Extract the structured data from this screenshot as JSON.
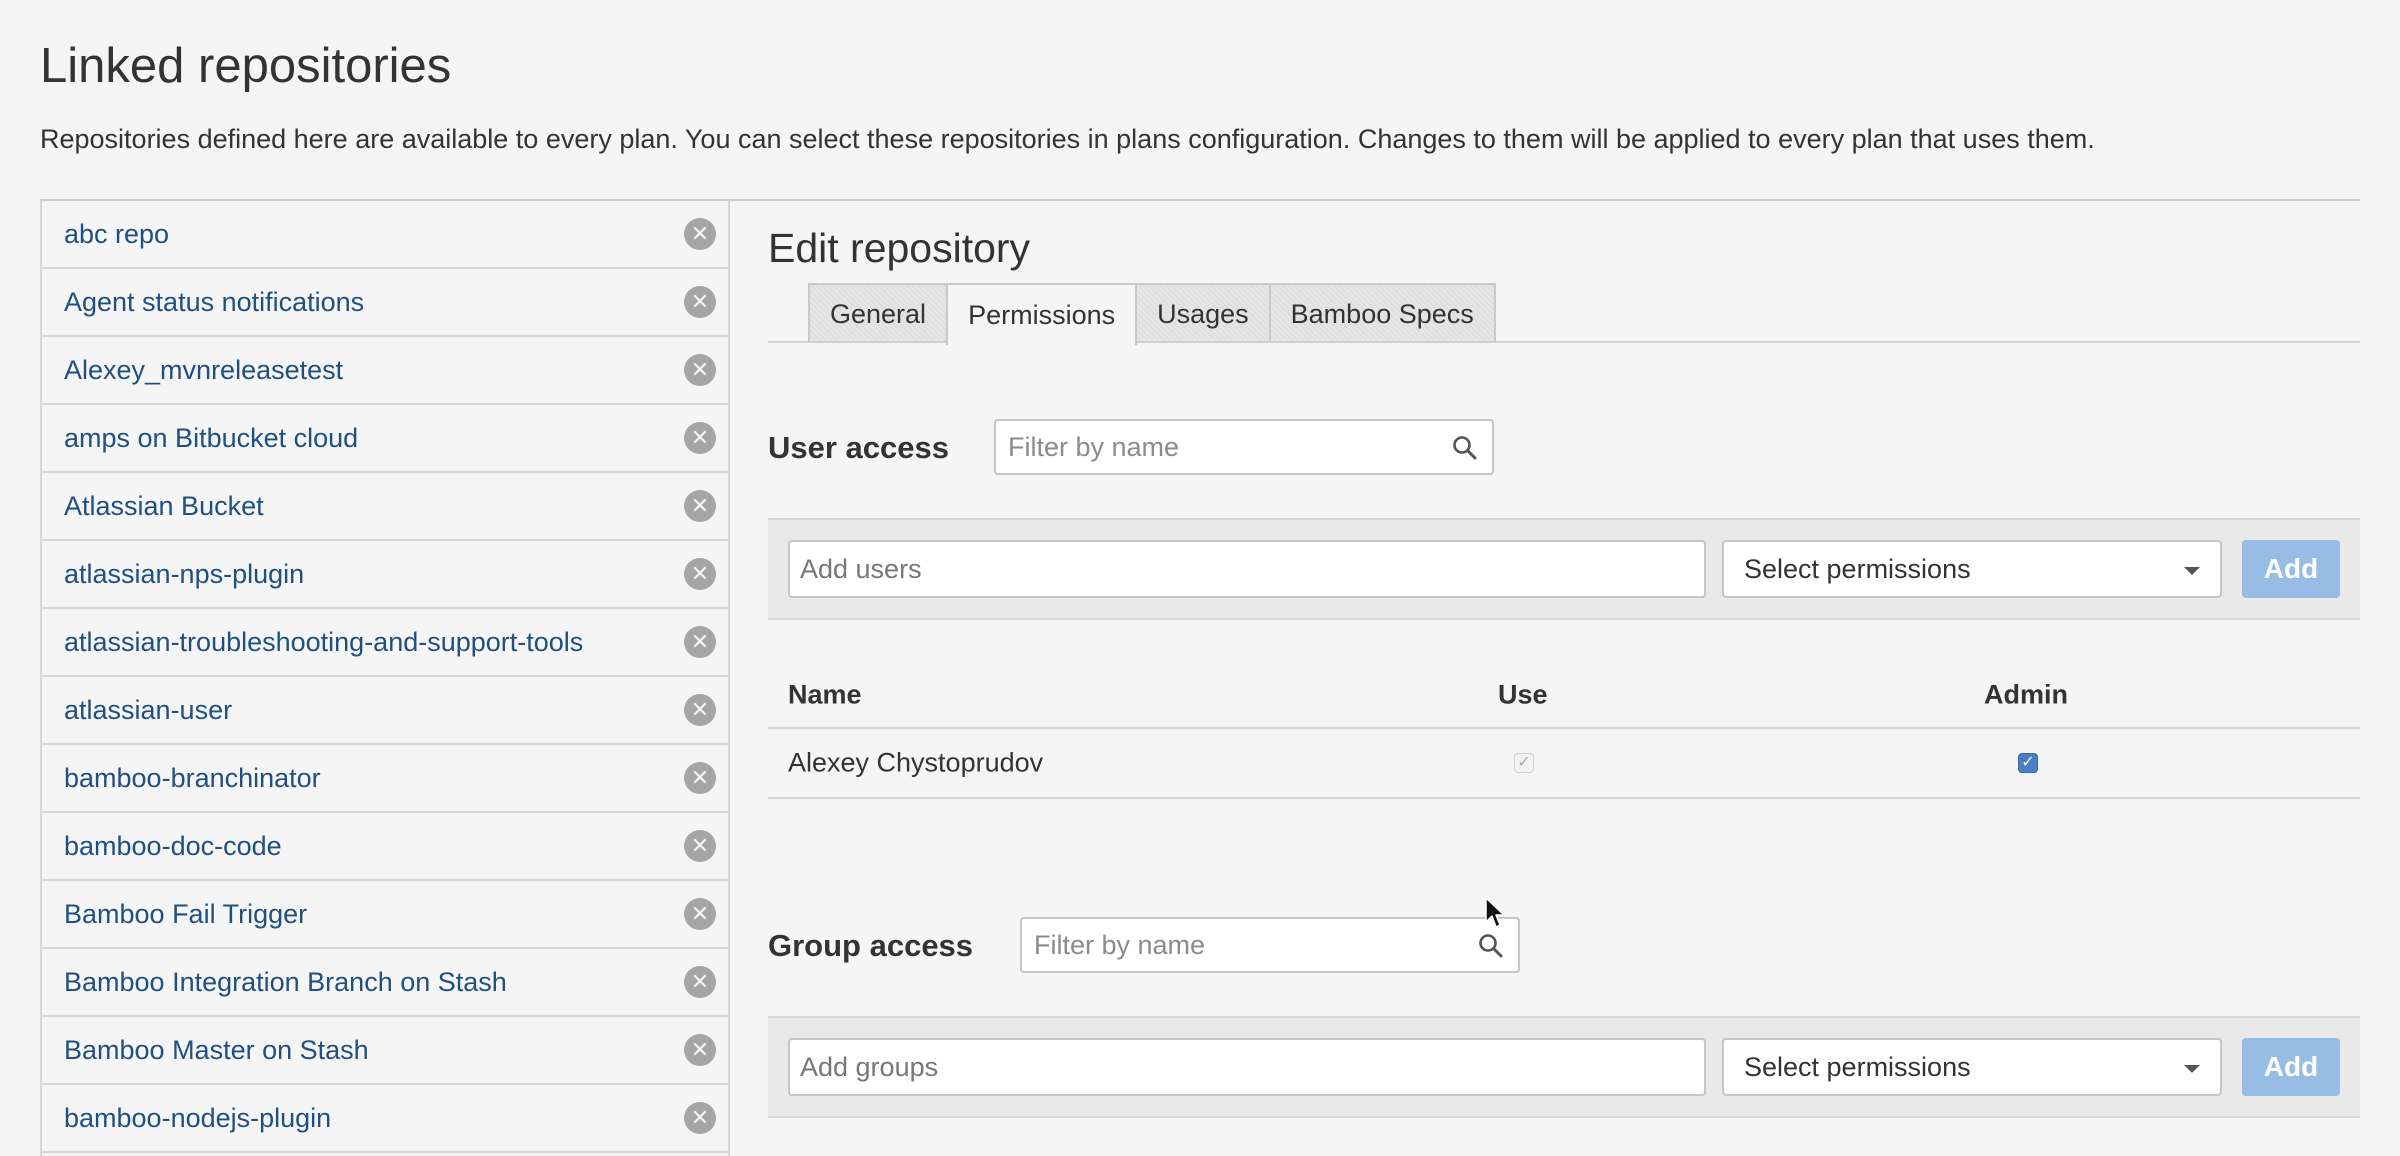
{
  "header": {
    "title": "Linked repositories",
    "description": "Repositories defined here are available to every plan. You can select these repositories in plans configuration. Changes to them will be applied to every plan that uses them."
  },
  "sidebar": {
    "items": [
      {
        "label": "abc repo"
      },
      {
        "label": "Agent status notifications"
      },
      {
        "label": "Alexey_mvnreleasetest"
      },
      {
        "label": "amps on Bitbucket cloud"
      },
      {
        "label": "Atlassian Bucket"
      },
      {
        "label": "atlassian-nps-plugin"
      },
      {
        "label": "atlassian-troubleshooting-and-support-tools"
      },
      {
        "label": "atlassian-user"
      },
      {
        "label": "bamboo-branchinator"
      },
      {
        "label": "bamboo-doc-code"
      },
      {
        "label": "Bamboo Fail Trigger"
      },
      {
        "label": "Bamboo Integration Branch on Stash"
      },
      {
        "label": "Bamboo Master on Stash"
      },
      {
        "label": "bamboo-nodejs-plugin"
      }
    ],
    "delete_icon": "close-circle-icon"
  },
  "editor": {
    "title": "Edit repository",
    "tabs": [
      {
        "label": "General",
        "active": false
      },
      {
        "label": "Permissions",
        "active": true
      },
      {
        "label": "Usages",
        "active": false
      },
      {
        "label": "Bamboo Specs",
        "active": false
      }
    ]
  },
  "user_access": {
    "label": "User access",
    "filter_placeholder": "Filter by name",
    "add_placeholder": "Add users",
    "select_label": "Select permissions",
    "add_button": "Add",
    "columns": {
      "name": "Name",
      "use": "Use",
      "admin": "Admin"
    },
    "rows": [
      {
        "name": "Alexey Chystoprudov",
        "use": true,
        "use_disabled": true,
        "admin": true
      }
    ]
  },
  "group_access": {
    "label": "Group access",
    "filter_placeholder": "Filter by name",
    "add_placeholder": "Add groups",
    "select_label": "Select permissions",
    "add_button": "Add"
  },
  "colors": {
    "link": "#205081",
    "add_button_bg": "#97bde4",
    "checkbox_checked": "#4a7fc1"
  }
}
